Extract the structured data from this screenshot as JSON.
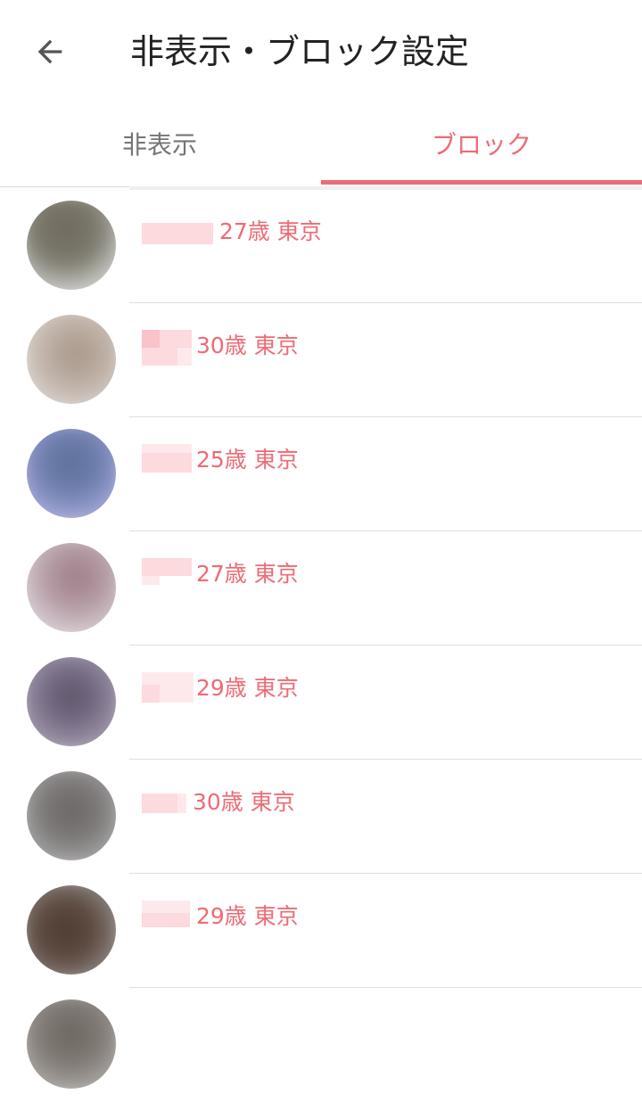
{
  "header": {
    "title": "非表示・ブロック設定"
  },
  "tabs": [
    {
      "label": "非表示",
      "active": false
    },
    {
      "label": "ブロック",
      "active": true
    }
  ],
  "colors": {
    "accent": "#ee6a74",
    "inactive_tab": "#757575",
    "divider": "#dedede"
  },
  "blocked_users": [
    {
      "age": "27歳",
      "location": "東京"
    },
    {
      "age": "30歳",
      "location": "東京"
    },
    {
      "age": "25歳",
      "location": "東京"
    },
    {
      "age": "27歳",
      "location": "東京"
    },
    {
      "age": "29歳",
      "location": "東京"
    },
    {
      "age": "30歳",
      "location": "東京"
    },
    {
      "age": "29歳",
      "location": "東京"
    },
    {
      "age": "",
      "location": ""
    }
  ]
}
